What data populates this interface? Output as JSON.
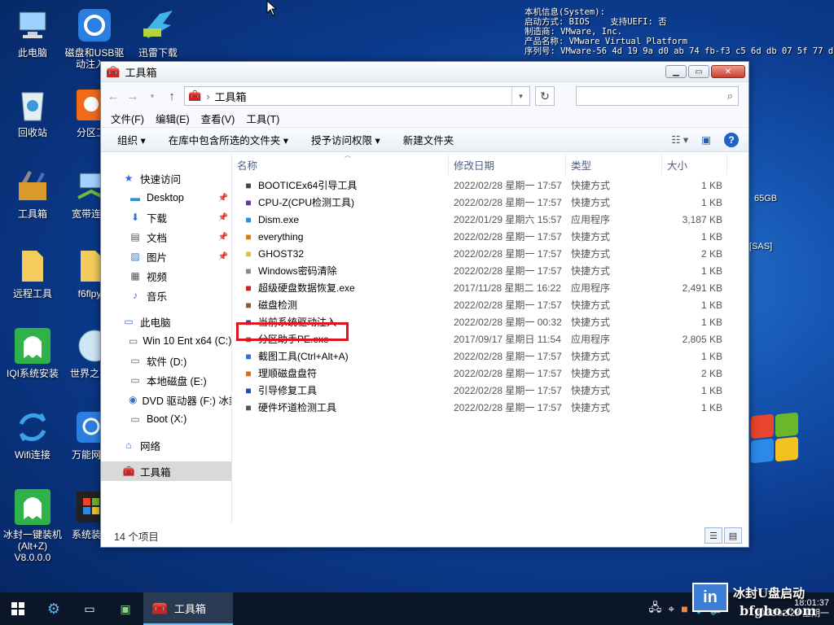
{
  "desktop_icons": [
    {
      "label": "此电脑",
      "icon": "computer-icon",
      "x": 0,
      "y": 0
    },
    {
      "label": "磁盘和USB驱动注入...",
      "icon": "disk-usb-icon"
    },
    {
      "label": "迅雷下载",
      "icon": "thunder-icon"
    },
    {
      "label": "回收站",
      "icon": "recycle-bin-icon"
    },
    {
      "label": "分区工",
      "icon": "partition-icon"
    },
    {
      "label": "工具箱",
      "icon": "toolbox-icon"
    },
    {
      "label": "宽带连接",
      "icon": "broadband-icon"
    },
    {
      "label": "远程工具",
      "icon": "folder-icon"
    },
    {
      "label": "f6flpy-",
      "icon": "folder-icon"
    },
    {
      "label": "IQI系统安装",
      "icon": "ghost-icon"
    },
    {
      "label": "世界之窗器",
      "icon": "browser-icon"
    },
    {
      "label": "Wifi连接",
      "icon": "wifi-icon"
    },
    {
      "label": "万能网卡",
      "icon": "network-card-icon"
    },
    {
      "label": "冰封一键装机(Alt+Z) V8.0.0.0",
      "icon": "ghost-icon"
    },
    {
      "label": "系统装机",
      "icon": "windows-icon"
    }
  ],
  "sysinfo": "本机信息(System):\n启动方式: BIOS    支持UEFI: 否\n制造商: VMware, Inc.\n产品名称: VMware Virtual Platform\n序列号: VMware-56 4d 19 9a d0 ab 74 fb-f3 c5 6d db 07 5f 77 d1",
  "side_notes": [
    "65GB",
    "[SAS]"
  ],
  "window": {
    "title": "工具箱",
    "address": "工具箱",
    "menu": [
      "文件(F)",
      "编辑(E)",
      "查看(V)",
      "工具(T)"
    ],
    "commands": [
      "组织 ▾",
      "在库中包含所选的文件夹 ▾",
      "授予访问权限 ▾",
      "新建文件夹"
    ],
    "nav": [
      {
        "label": "快速访问",
        "icon": "star-icon",
        "indent": 1,
        "pin": ""
      },
      {
        "label": "Desktop",
        "icon": "desktop-icon",
        "indent": 2,
        "pin": "📌"
      },
      {
        "label": "下载",
        "icon": "download-icon",
        "indent": 2,
        "pin": "📌"
      },
      {
        "label": "文档",
        "icon": "document-icon",
        "indent": 2,
        "pin": "📌"
      },
      {
        "label": "图片",
        "icon": "picture-icon",
        "indent": 2,
        "pin": "📌"
      },
      {
        "label": "视频",
        "icon": "video-icon",
        "indent": 2,
        "pin": ""
      },
      {
        "label": "音乐",
        "icon": "music-icon",
        "indent": 2,
        "pin": ""
      },
      {
        "label": "",
        "icon": "",
        "indent": 0,
        "pin": ""
      },
      {
        "label": "此电脑",
        "icon": "computer-icon",
        "indent": 1,
        "pin": ""
      },
      {
        "label": "Win 10 Ent x64 (C:)",
        "icon": "drive-icon",
        "indent": 2,
        "pin": ""
      },
      {
        "label": "软件 (D:)",
        "icon": "drive-icon",
        "indent": 2,
        "pin": ""
      },
      {
        "label": "本地磁盘 (E:)",
        "icon": "drive-icon",
        "indent": 2,
        "pin": ""
      },
      {
        "label": "DVD 驱动器 (F:) 冰封",
        "icon": "dvd-icon",
        "indent": 2,
        "pin": ""
      },
      {
        "label": "Boot (X:)",
        "icon": "drive-icon",
        "indent": 2,
        "pin": ""
      },
      {
        "label": "",
        "icon": "",
        "indent": 0,
        "pin": ""
      },
      {
        "label": "网络",
        "icon": "network-icon",
        "indent": 1,
        "pin": ""
      },
      {
        "label": "",
        "icon": "",
        "indent": 0,
        "pin": ""
      },
      {
        "label": "工具箱",
        "icon": "toolbox-icon",
        "indent": 1,
        "pin": "",
        "selected": true
      }
    ],
    "columns": [
      "名称",
      "修改日期",
      "类型",
      "大小"
    ],
    "files": [
      {
        "name": "BOOTICEx64引导工具",
        "date": "2022/02/28 星期一 17:57",
        "type": "快捷方式",
        "size": "1 KB",
        "icon": "bootice-icon",
        "color": "#444"
      },
      {
        "name": "CPU-Z(CPU检测工具)",
        "date": "2022/02/28 星期一 17:57",
        "type": "快捷方式",
        "size": "1 KB",
        "icon": "cpuz-icon",
        "color": "#6b2fa8"
      },
      {
        "name": "Dism.exe",
        "date": "2022/01/29 星期六 15:57",
        "type": "应用程序",
        "size": "3,187 KB",
        "icon": "gear-icon",
        "color": "#2f8fd6"
      },
      {
        "name": "everything",
        "date": "2022/02/28 星期一 17:57",
        "type": "快捷方式",
        "size": "1 KB",
        "icon": "search-icon",
        "color": "#e07b00"
      },
      {
        "name": "GHOST32",
        "date": "2022/02/28 星期一 17:57",
        "type": "快捷方式",
        "size": "2 KB",
        "icon": "ghost-icon",
        "color": "#d8c24a"
      },
      {
        "name": "Windows密码清除",
        "date": "2022/02/28 星期一 17:57",
        "type": "快捷方式",
        "size": "1 KB",
        "icon": "key-icon",
        "color": "#888"
      },
      {
        "name": "超级硬盘数据恢复.exe",
        "date": "2017/11/28 星期二 16:22",
        "type": "应用程序",
        "size": "2,491 KB",
        "icon": "recovery-icon",
        "color": "#d01c1c"
      },
      {
        "name": "磁盘检测",
        "date": "2022/02/28 星期一 17:57",
        "type": "快捷方式",
        "size": "1 KB",
        "icon": "disk-check-icon",
        "color": "#8a5a2a"
      },
      {
        "name": "当前系统驱动注入",
        "date": "2022/02/28 星期一 00:32",
        "type": "快捷方式",
        "size": "1 KB",
        "icon": "driver-inject-icon",
        "color": "#1d4fa8"
      },
      {
        "name": "分区助手PE.exe",
        "date": "2017/09/17 星期日 11:54",
        "type": "应用程序",
        "size": "2,805 KB",
        "icon": "partition-icon",
        "color": "#2a9a3a"
      },
      {
        "name": "截图工具(Ctrl+Alt+A)",
        "date": "2022/02/28 星期一 17:57",
        "type": "快捷方式",
        "size": "1 KB",
        "icon": "scissors-icon",
        "color": "#2f6fd6"
      },
      {
        "name": "理顺磁盘盘符",
        "date": "2022/02/28 星期一 17:57",
        "type": "快捷方式",
        "size": "2 KB",
        "icon": "drive-letter-icon",
        "color": "#e06a00"
      },
      {
        "name": "引导修复工具",
        "date": "2022/02/28 星期一 17:57",
        "type": "快捷方式",
        "size": "1 KB",
        "icon": "boot-repair-icon",
        "color": "#1d4fa8"
      },
      {
        "name": "硬件坏道检测工具",
        "date": "2022/02/28 星期一 17:57",
        "type": "快捷方式",
        "size": "1 KB",
        "icon": "hdd-scan-icon",
        "color": "#555"
      }
    ],
    "status": "14 个项目"
  },
  "taskbar": {
    "active_label": "工具箱",
    "clock_time": "18:01:37",
    "clock_date": "2022/02/28 星期一"
  },
  "watermark": {
    "badge": "in",
    "text": "冰封U盘启动",
    "url": "bfgho.com"
  }
}
